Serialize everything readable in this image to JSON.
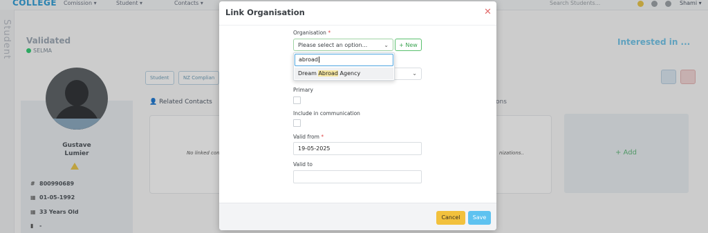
{
  "background": {
    "brand": "COLLEGE",
    "nav_items": [
      "Comission ▾",
      "Student ▾",
      "Contacts ▾"
    ],
    "search_placeholder": "Search Students...",
    "user": "Shami ▾",
    "sidebar_label": "Student",
    "status_title": "Validated",
    "status_sub": "SELMA",
    "right_title": "Interested in ...",
    "tabs": [
      "Student",
      "NZ Complian"
    ],
    "related_contacts": "Related Contacts",
    "organisations_suffix": "ons",
    "no_linked": "No linked con",
    "nizations": "nizations..",
    "add": "+ Add",
    "person_name_line1": "Gustave",
    "person_name_line2": "Lumier",
    "info": [
      {
        "icon": "#",
        "text": "800990689"
      },
      {
        "icon": "▦",
        "text": "01-05-1992"
      },
      {
        "icon": "▦",
        "text": "33 Years Old"
      },
      {
        "icon": "▮",
        "text": "-"
      }
    ]
  },
  "modal": {
    "title": "Link Organisation",
    "organisation_label": "Organisation",
    "required_mark": "*",
    "select_placeholder": "Please select an option...",
    "new_button": "+ New",
    "search_value": "abroad",
    "option": {
      "before": "Dream ",
      "match": "Abroad",
      "after": " Agency"
    },
    "primary_label": "Primary",
    "include_label": "Include in communication",
    "valid_from_label": "Valid from",
    "valid_from_value": "19-05-2025",
    "valid_to_label": "Valid to",
    "valid_to_value": "",
    "cancel": "Cancel",
    "save": "Save"
  },
  "colors": {
    "accent": "#5ec2f0",
    "cancel": "#f2c13d",
    "new_green": "#3aa350",
    "close_red": "#e26a6a"
  }
}
